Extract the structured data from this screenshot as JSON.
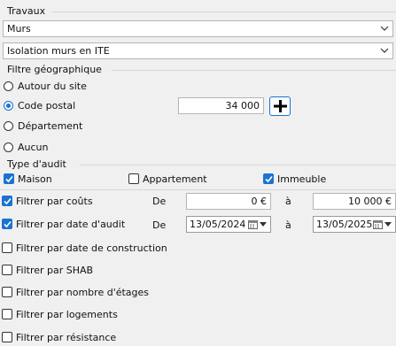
{
  "travaux": {
    "title": "Travaux",
    "combo1": "Murs",
    "combo2": "Isolation murs en ITE"
  },
  "filtre_geo": {
    "title": "Filtre géographique",
    "options": [
      "Autour du site",
      "Code postal",
      "Département",
      "Aucun"
    ],
    "selected": "Code postal",
    "code_postal_value": "34 000"
  },
  "type_audit": {
    "title": "Type d'audit",
    "options": [
      {
        "label": "Maison",
        "checked": true
      },
      {
        "label": "Appartement",
        "checked": false
      },
      {
        "label": "Immeuble",
        "checked": true
      }
    ]
  },
  "filters": {
    "couts": {
      "label": "Filtrer par coûts",
      "checked": true,
      "from_label": "De",
      "to_label": "à",
      "from": "0 €",
      "to": "10 000 €"
    },
    "date_audit": {
      "label": "Filtrer par date d'audit",
      "checked": true,
      "from_label": "De",
      "to_label": "à",
      "from": "13/05/2024",
      "to": "13/05/2025"
    },
    "construction": {
      "label": "Filtrer par date de construction",
      "checked": false
    },
    "shab": {
      "label": "Filtrer par SHAB",
      "checked": false
    },
    "etages": {
      "label": "Filtrer par nombre d'étages",
      "checked": false
    },
    "logements": {
      "label": "Filtrer par logements",
      "checked": false
    },
    "resistance": {
      "label": "Filtrer par résistance",
      "checked": false
    }
  },
  "colors": {
    "accent": "#1a73d1",
    "background": "#f0f0f0"
  }
}
